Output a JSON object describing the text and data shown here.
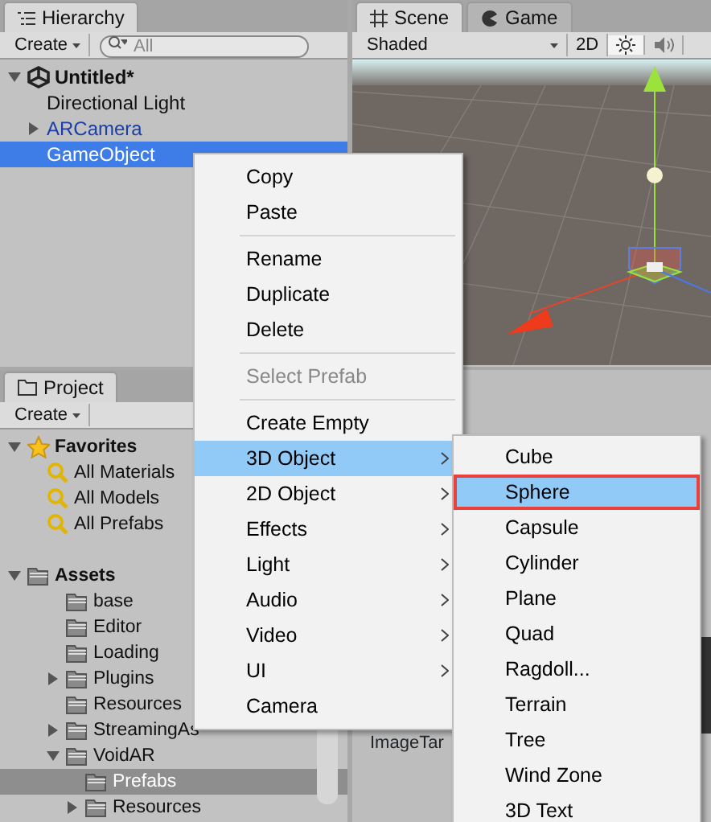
{
  "hierarchy": {
    "tab_label": "Hierarchy",
    "create_button": "Create",
    "search": {
      "placeholder": "All"
    },
    "scene": {
      "name": "Untitled*",
      "expanded": true
    },
    "objects": [
      {
        "name": "Directional Light",
        "kind": "plain",
        "has_children": false,
        "selected": false
      },
      {
        "name": "ARCamera",
        "kind": "prefab",
        "has_children": true,
        "selected": false
      },
      {
        "name": "GameObject",
        "kind": "plain",
        "has_children": false,
        "selected": true
      }
    ]
  },
  "scene_view": {
    "tabs": [
      {
        "label": "Scene",
        "kind": "scene",
        "selected": true
      },
      {
        "label": "Game",
        "kind": "game",
        "selected": false
      }
    ],
    "shading": "Shaded",
    "mode_2d": {
      "label": "2D",
      "on": false
    },
    "lighting_on": true,
    "audio_on": false
  },
  "project": {
    "tab_label": "Project",
    "create_button": "Create",
    "favorites": {
      "label": "Favorites",
      "expanded": true,
      "items": [
        "All Materials",
        "All Models",
        "All Prefabs"
      ]
    },
    "assets": {
      "label": "Assets",
      "expanded": true,
      "children": [
        {
          "name": "base",
          "selected": false
        },
        {
          "name": "Editor",
          "selected": false
        },
        {
          "name": "Loading",
          "selected": false
        },
        {
          "name": "Plugins",
          "expanded": false,
          "selected": false,
          "has_children": true
        },
        {
          "name": "Resources",
          "selected": false
        },
        {
          "name": "StreamingAs",
          "expanded": false,
          "selected": false,
          "has_children": true
        },
        {
          "name": "VoidAR",
          "expanded": true,
          "selected": false,
          "has_children": true,
          "children": [
            {
              "name": "Prefabs",
              "selected": true
            },
            {
              "name": "Resources",
              "expanded": false,
              "selected": false,
              "has_children": true
            }
          ]
        }
      ]
    },
    "asset_label": "ImageTar"
  },
  "context_menu": {
    "items": [
      {
        "kind": "item",
        "label": "Copy",
        "disabled": false,
        "selected": false
      },
      {
        "kind": "item",
        "label": "Paste",
        "disabled": false,
        "selected": false
      },
      {
        "kind": "separator"
      },
      {
        "kind": "item",
        "label": "Rename",
        "disabled": false,
        "selected": false
      },
      {
        "kind": "item",
        "label": "Duplicate",
        "disabled": false,
        "selected": false
      },
      {
        "kind": "item",
        "label": "Delete",
        "disabled": false,
        "selected": false
      },
      {
        "kind": "separator"
      },
      {
        "kind": "item",
        "label": "Select Prefab",
        "disabled": true,
        "selected": false
      },
      {
        "kind": "separator"
      },
      {
        "kind": "item",
        "label": "Create Empty",
        "disabled": false,
        "selected": false
      },
      {
        "kind": "submenu",
        "label": "3D Object",
        "disabled": false,
        "selected": true
      },
      {
        "kind": "submenu",
        "label": "2D Object",
        "disabled": false,
        "selected": false
      },
      {
        "kind": "submenu",
        "label": "Effects",
        "disabled": false,
        "selected": false
      },
      {
        "kind": "submenu",
        "label": "Light",
        "disabled": false,
        "selected": false
      },
      {
        "kind": "submenu",
        "label": "Audio",
        "disabled": false,
        "selected": false
      },
      {
        "kind": "submenu",
        "label": "Video",
        "disabled": false,
        "selected": false
      },
      {
        "kind": "submenu",
        "label": "UI",
        "disabled": false,
        "selected": false
      },
      {
        "kind": "item",
        "label": "Camera",
        "disabled": false,
        "selected": false
      }
    ]
  },
  "submenu": {
    "items": [
      {
        "label": "Cube",
        "selected": false
      },
      {
        "label": "Sphere",
        "selected": true
      },
      {
        "label": "Capsule",
        "selected": false
      },
      {
        "label": "Cylinder",
        "selected": false
      },
      {
        "label": "Plane",
        "selected": false
      },
      {
        "label": "Quad",
        "selected": false
      },
      {
        "label": "Ragdoll...",
        "selected": false
      },
      {
        "label": "Terrain",
        "selected": false
      },
      {
        "label": "Tree",
        "selected": false
      },
      {
        "label": "Wind Zone",
        "selected": false
      },
      {
        "label": "3D Text",
        "selected": false
      }
    ]
  }
}
